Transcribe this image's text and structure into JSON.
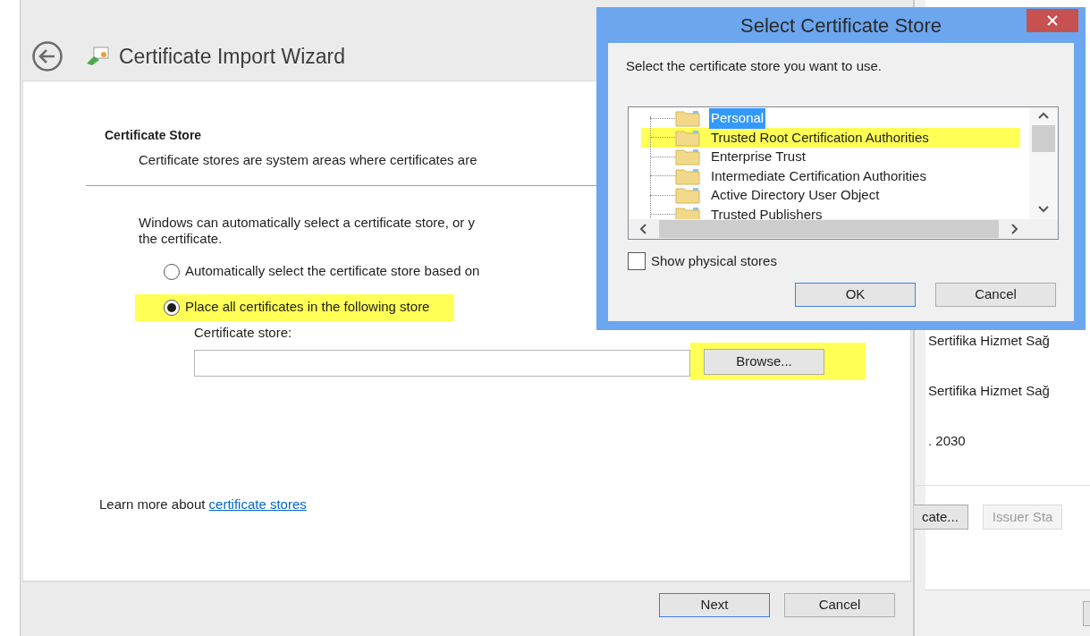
{
  "background_window": {
    "lines": [
      "Sertifika Hizmet Sağ",
      "Sertifika Hizmet Sağ",
      ". 2030"
    ],
    "buttons": [
      {
        "label": "cate...",
        "disabled": false
      },
      {
        "label": "Issuer Sta",
        "disabled": true
      }
    ]
  },
  "wizard": {
    "title": "Certificate Import Wizard",
    "section_title": "Certificate Store",
    "section_description": "Certificate stores are system areas where certificates are",
    "intro_lines": [
      "Windows can automatically select a certificate store, or y",
      "the certificate."
    ],
    "options": [
      {
        "label": "Automatically select the certificate store based on",
        "selected": false,
        "highlighted": false
      },
      {
        "label": "Place all certificates in the following store",
        "selected": true,
        "highlighted": true
      }
    ],
    "store_field": {
      "label": "Certificate store:"
    },
    "browse_button": {
      "label": "Browse...",
      "highlighted": true
    },
    "learn_more": {
      "text": "Learn more about",
      "link": "certificate stores"
    },
    "buttons": [
      {
        "label": "Next",
        "default": true
      },
      {
        "label": "Cancel",
        "default": false
      }
    ]
  },
  "dialog": {
    "title": "Select Certificate Store",
    "prompt": "Select the certificate store you want to use.",
    "stores": [
      {
        "label": "Personal",
        "selected": true,
        "highlighted": false
      },
      {
        "label": "Trusted Root Certification Authorities",
        "selected": false,
        "highlighted": true
      },
      {
        "label": "Enterprise Trust",
        "selected": false,
        "highlighted": false
      },
      {
        "label": "Intermediate Certification Authorities",
        "selected": false,
        "highlighted": false
      },
      {
        "label": "Active Directory User Object",
        "selected": false,
        "highlighted": false
      },
      {
        "label": "Trusted Publishers",
        "selected": false,
        "highlighted": false
      }
    ],
    "show_physical": {
      "label": "Show physical stores",
      "checked": false
    },
    "buttons": [
      {
        "label": "OK",
        "default": true
      },
      {
        "label": "Cancel",
        "default": false
      }
    ]
  }
}
